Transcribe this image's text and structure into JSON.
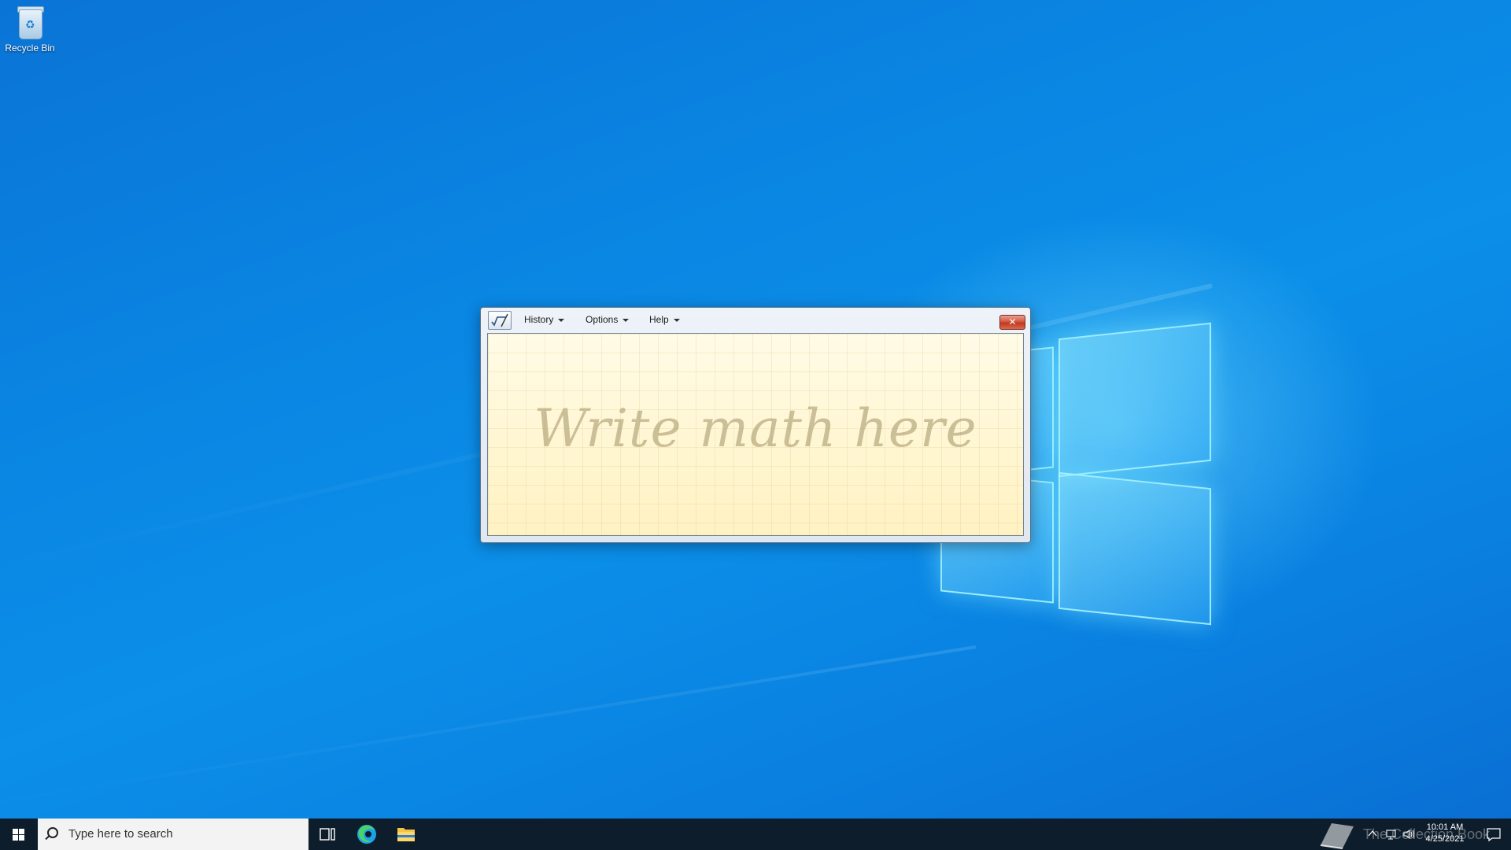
{
  "desktop": {
    "icons": [
      {
        "label": "Recycle Bin",
        "icon": "recycle-bin-icon"
      }
    ]
  },
  "window": {
    "app_icon": "math-input-panel-icon",
    "menu": {
      "history": "History",
      "options": "Options",
      "help": "Help"
    },
    "close_glyph": "✕",
    "canvas_hint": "Write math here",
    "colors": {
      "paper": "#fff7d4",
      "close_button": "#c0391f"
    }
  },
  "taskbar": {
    "start_icon": "windows-start-icon",
    "search_placeholder": "Type here to search",
    "pinned": [
      "task-view-icon",
      "edge-icon",
      "file-explorer-icon"
    ],
    "tray": {
      "time": "10:01 AM",
      "date": "4/25/2021",
      "watermark": "The Collection Book"
    }
  }
}
